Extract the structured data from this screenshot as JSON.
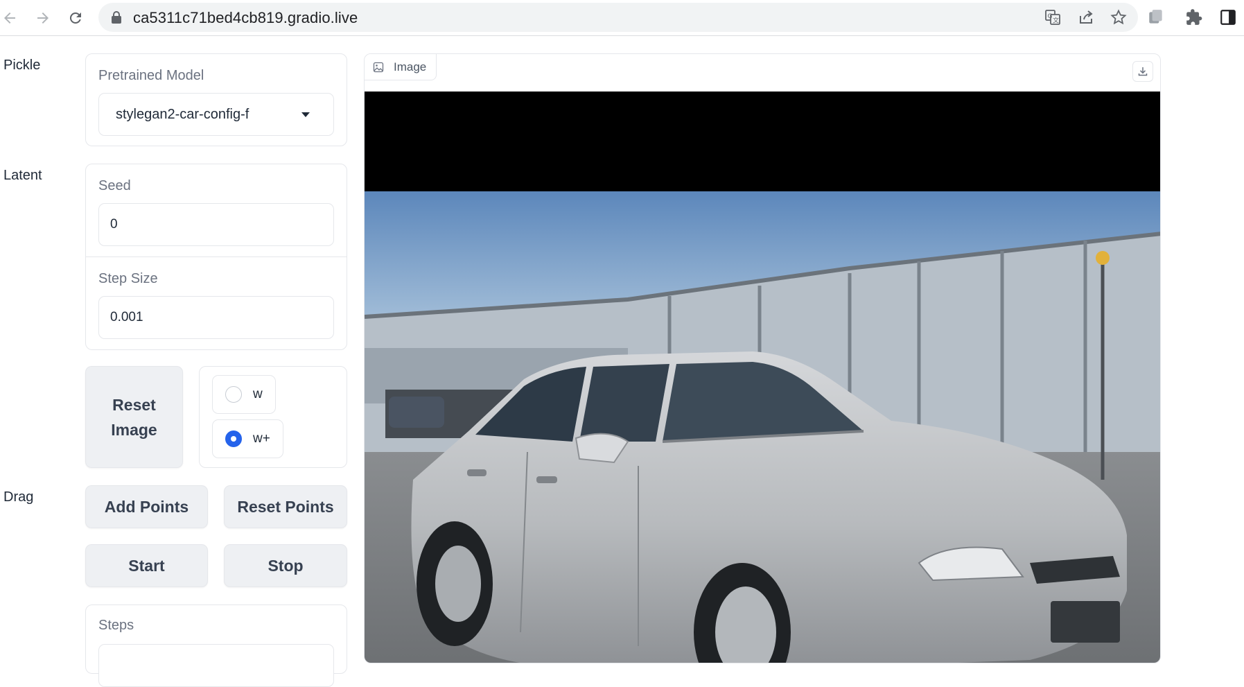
{
  "browser": {
    "url": "ca5311c71bed4cb819.gradio.live",
    "icons": [
      "back-arrow-icon",
      "forward-arrow-icon",
      "reload-icon",
      "lock-icon",
      "translate-icon",
      "share-icon",
      "star-icon",
      "tab-search-icon",
      "extensions-icon",
      "sidebar-icon"
    ]
  },
  "sections": {
    "pickle": "Pickle",
    "latent": "Latent",
    "drag": "Drag"
  },
  "pretrained_model": {
    "label": "Pretrained Model",
    "value": "stylegan2-car-config-f"
  },
  "seed": {
    "label": "Seed",
    "value": "0"
  },
  "step_size": {
    "label": "Step Size",
    "value": "0.001"
  },
  "buttons": {
    "reset_image": "Reset Image",
    "add_points": "Add Points",
    "reset_points": "Reset Points",
    "start": "Start",
    "stop": "Stop"
  },
  "latent_space": {
    "options": [
      "w",
      "w+"
    ],
    "selected": "w+"
  },
  "steps": {
    "label": "Steps"
  },
  "image_panel": {
    "label": "Image"
  },
  "colors": {
    "accent": "#2563eb",
    "button_bg": "#eef0f3",
    "border": "#e5e7eb"
  }
}
